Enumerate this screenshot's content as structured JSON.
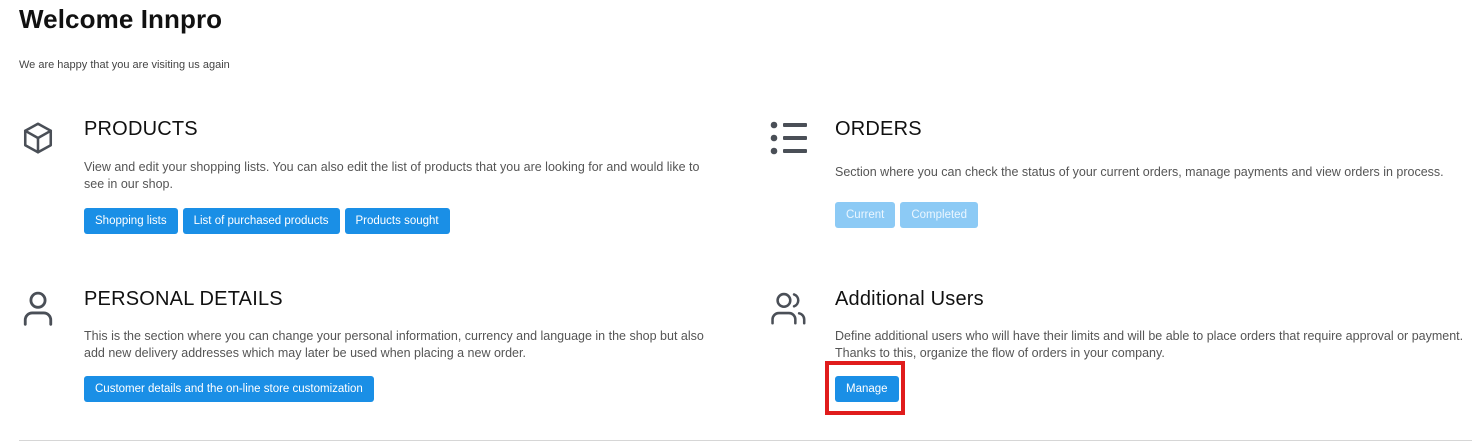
{
  "header": {
    "title": "Welcome Innpro",
    "subtitle": "We are happy that you are visiting us again"
  },
  "sections": {
    "products": {
      "icon": "cube-icon",
      "title": "PRODUCTS",
      "description": "View and edit your shopping lists. You can also edit the list of products that you are looking for and would like to see in our shop.",
      "buttons": [
        "Shopping lists",
        "List of purchased products",
        "Products sought"
      ]
    },
    "orders": {
      "icon": "list-icon",
      "title": "ORDERS",
      "description": "Section where you can check the status of your current orders, manage payments and view orders in process.",
      "buttons": [
        "Current",
        "Completed"
      ]
    },
    "personal": {
      "icon": "user-icon",
      "title": "PERSONAL DETAILS",
      "description": "This is the section where you can change your personal information, currency and language in the shop but also add new delivery addresses which may later be used when placing a new order.",
      "buttons": [
        "Customer details and the on-line store customization"
      ]
    },
    "users": {
      "icon": "users-icon",
      "title": "Additional Users",
      "description": "Define additional users who will have their limits and will be able to place orders that require approval or payment. Thanks to this, organize the flow of orders in your company.",
      "buttons": [
        "Manage"
      ]
    }
  },
  "colors": {
    "primary": "#1a8fe6",
    "disabled": "#8ccaf5",
    "highlight": "#e01c1c",
    "icon": "#4a4f57"
  }
}
